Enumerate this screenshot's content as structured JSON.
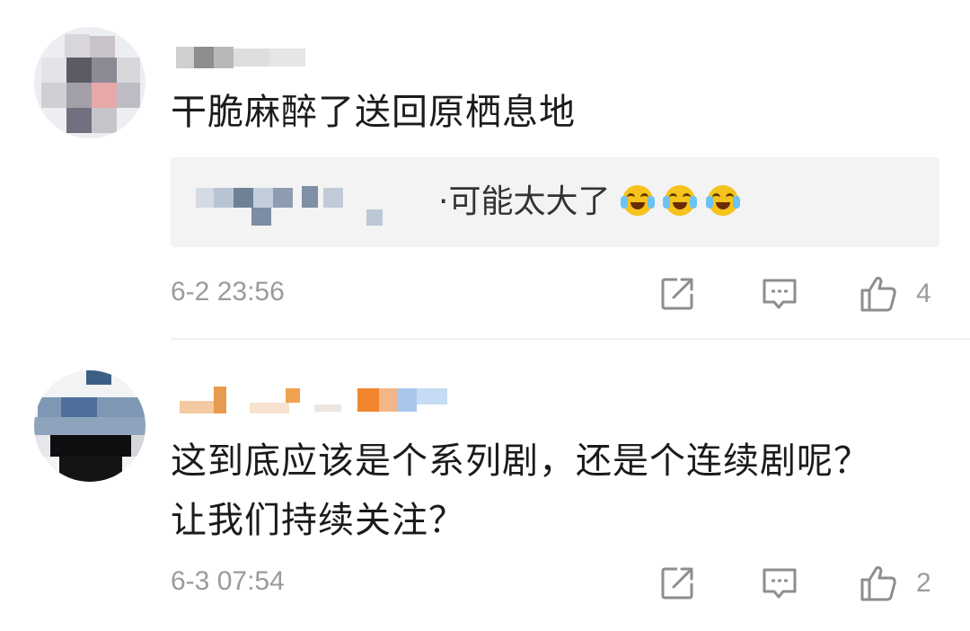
{
  "comments": [
    {
      "text_lines": [
        "干脆麻醉了送回原栖息地"
      ],
      "reply": {
        "text": "·可能太大了",
        "emoji_icons": [
          "laugh-cry-icon",
          "laugh-cry-icon",
          "laugh-cry-icon"
        ]
      },
      "time": "6-2 23:56",
      "likes": "4"
    },
    {
      "text_lines": [
        "这到底应该是个系列剧，还是个连续剧呢？",
        "让我们持续关注？"
      ],
      "time": "6-3 07:54",
      "likes": "2"
    }
  ],
  "icons": {
    "share": "share-icon",
    "reply": "comment-icon",
    "like": "thumbs-up-icon"
  },
  "colors": {
    "meta_gray": "#9b9b9b",
    "reply_bg": "#f3f3f3",
    "emoji_yellow": "#f6c21c"
  }
}
